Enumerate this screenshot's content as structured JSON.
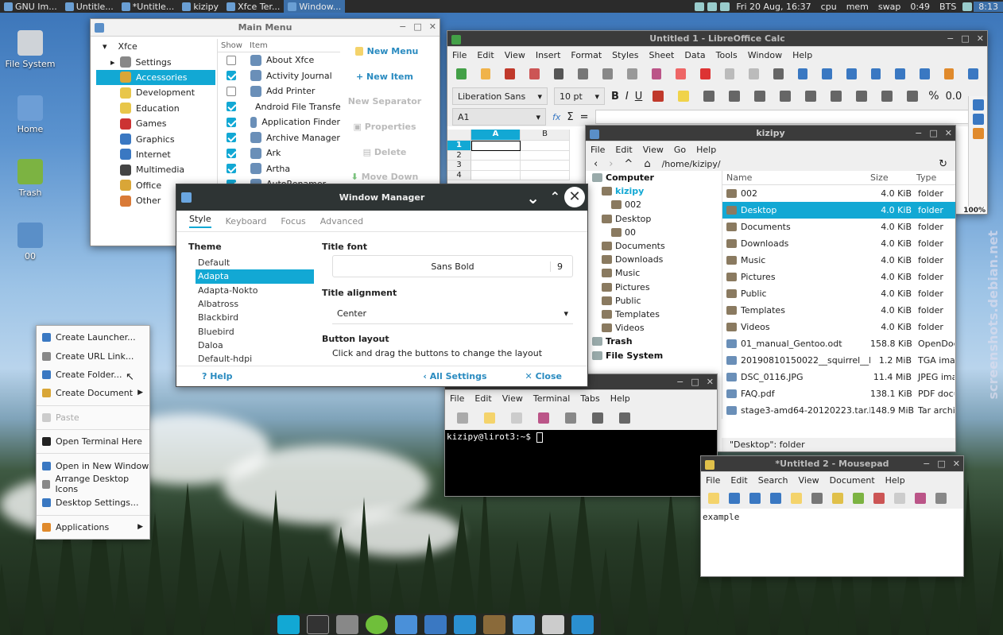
{
  "panel": {
    "tasks": [
      {
        "label": "GNU Im...",
        "active": false
      },
      {
        "label": "Untitle...",
        "active": false
      },
      {
        "label": "*Untitle...",
        "active": false
      },
      {
        "label": "kizipy",
        "active": false
      },
      {
        "label": "Xfce Ter...",
        "active": false
      },
      {
        "label": "Window...",
        "active": true
      }
    ],
    "clock": "Fri 20 Aug, 16:37",
    "cpu": "cpu",
    "mem": "mem",
    "swap": "swap",
    "uptime": "0:49",
    "bts": "BTS",
    "time": "8:13"
  },
  "desktop": {
    "icons": [
      {
        "label": "File System"
      },
      {
        "label": "Home"
      },
      {
        "label": "Trash"
      },
      {
        "label": "00"
      }
    ],
    "watermark": "screenshots.debian.net"
  },
  "main_menu": {
    "title": "Main Menu",
    "root": "Xfce",
    "categories": [
      "Settings",
      "Accessories",
      "Development",
      "Education",
      "Games",
      "Graphics",
      "Internet",
      "Multimedia",
      "Office",
      "Other"
    ],
    "selected_category": "Accessories",
    "col_show": "Show",
    "col_item": "Item",
    "items": [
      {
        "label": "About Xfce",
        "checked": false
      },
      {
        "label": "Activity Journal",
        "checked": true
      },
      {
        "label": "Add Printer",
        "checked": false
      },
      {
        "label": "Android File Transfe",
        "checked": true
      },
      {
        "label": "Application Finder",
        "checked": true
      },
      {
        "label": "Archive Manager",
        "checked": true
      },
      {
        "label": "Ark",
        "checked": true
      },
      {
        "label": "Artha",
        "checked": true
      },
      {
        "label": "AutoRenamer",
        "checked": true
      }
    ],
    "buttons": {
      "new_menu": "New Menu",
      "new_item": "New Item",
      "new_separator": "New Separator",
      "properties": "Properties",
      "delete": "Delete",
      "move_down": "Move Down"
    }
  },
  "calc": {
    "title": "Untitled 1 - LibreOffice Calc",
    "menu": [
      "File",
      "Edit",
      "View",
      "Insert",
      "Format",
      "Styles",
      "Sheet",
      "Data",
      "Tools",
      "Window",
      "Help"
    ],
    "font_name": "Liberation Sans",
    "font_size": "10 pt",
    "cell_ref": "A1",
    "col_a": "A",
    "col_b": "B",
    "rows": [
      "1",
      "2",
      "3",
      "4"
    ],
    "bold": "B",
    "italic": "I",
    "underline": "U",
    "fx": "fx",
    "sigma": "Σ",
    "equals": "=",
    "percent": "%",
    "decimal": "0.0",
    "zoom": "100%"
  },
  "window_manager": {
    "title": "Window Manager",
    "tabs": [
      "Style",
      "Keyboard",
      "Focus",
      "Advanced"
    ],
    "theme_label": "Theme",
    "themes": [
      "Default",
      "Adapta",
      "Adapta-Nokto",
      "Albatross",
      "Blackbird",
      "Bluebird",
      "Daloa",
      "Default-hdpi"
    ],
    "selected_theme": "Adapta",
    "title_font_label": "Title font",
    "font_value": "Sans Bold",
    "font_size": "9",
    "alignment_label": "Title alignment",
    "alignment_value": "Center",
    "button_layout_label": "Button layout",
    "button_layout_hint": "Click and drag the buttons to change the layout",
    "help": "Help",
    "all_settings": "All Settings",
    "close": "Close"
  },
  "thunar": {
    "title": "kizipy",
    "menu": [
      "File",
      "Edit",
      "View",
      "Go",
      "Help"
    ],
    "path": "/home/kizipy/",
    "sidebar": [
      {
        "label": "Computer",
        "level": 0,
        "bold": true
      },
      {
        "label": "kizipy",
        "level": 1,
        "bold": true
      },
      {
        "label": "002",
        "level": 2
      },
      {
        "label": "Desktop",
        "level": 1
      },
      {
        "label": "00",
        "level": 2
      },
      {
        "label": "Documents",
        "level": 1
      },
      {
        "label": "Downloads",
        "level": 1
      },
      {
        "label": "Music",
        "level": 1
      },
      {
        "label": "Pictures",
        "level": 1
      },
      {
        "label": "Public",
        "level": 1
      },
      {
        "label": "Templates",
        "level": 1
      },
      {
        "label": "Videos",
        "level": 1
      },
      {
        "label": "Trash",
        "level": 0,
        "bold": true
      },
      {
        "label": "File System",
        "level": 0,
        "bold": true
      }
    ],
    "columns": {
      "name": "Name",
      "size": "Size",
      "type": "Type"
    },
    "files": [
      {
        "name": "002",
        "size": "4.0 KiB",
        "type": "folder"
      },
      {
        "name": "Desktop",
        "size": "4.0 KiB",
        "type": "folder",
        "selected": true
      },
      {
        "name": "Documents",
        "size": "4.0 KiB",
        "type": "folder"
      },
      {
        "name": "Downloads",
        "size": "4.0 KiB",
        "type": "folder"
      },
      {
        "name": "Music",
        "size": "4.0 KiB",
        "type": "folder"
      },
      {
        "name": "Pictures",
        "size": "4.0 KiB",
        "type": "folder"
      },
      {
        "name": "Public",
        "size": "4.0 KiB",
        "type": "folder"
      },
      {
        "name": "Templates",
        "size": "4.0 KiB",
        "type": "folder"
      },
      {
        "name": "Videos",
        "size": "4.0 KiB",
        "type": "folder"
      },
      {
        "name": "01_manual_Gentoo.odt",
        "size": "158.8 KiB",
        "type": "OpenDocu"
      },
      {
        "name": "20190810150022__squirrel__b...",
        "size": "1.2 MiB",
        "type": "TGA imag"
      },
      {
        "name": "DSC_0116.JPG",
        "size": "11.4 MiB",
        "type": "JPEG imag"
      },
      {
        "name": "FAQ.pdf",
        "size": "138.1 KiB",
        "type": "PDF docu"
      },
      {
        "name": "stage3-amd64-20120223.tar.b...",
        "size": "148.9 MiB",
        "type": "Tar archiv"
      }
    ],
    "status": "\"Desktop\": folder"
  },
  "terminal": {
    "menu": [
      "File",
      "Edit",
      "View",
      "Terminal",
      "Tabs",
      "Help"
    ],
    "prompt": "kizipy@lirot3:~$ "
  },
  "mousepad": {
    "title": "*Untitled 2 - Mousepad",
    "menu": [
      "File",
      "Edit",
      "Search",
      "View",
      "Document",
      "Help"
    ],
    "content": "example"
  },
  "context_menu": {
    "items": [
      {
        "label": "Create Launcher...",
        "enabled": true
      },
      {
        "label": "Create URL Link...",
        "enabled": true
      },
      {
        "label": "Create Folder...",
        "enabled": true
      },
      {
        "label": "Create Document",
        "enabled": true,
        "submenu": true
      },
      {
        "sep": true
      },
      {
        "label": "Paste",
        "enabled": false
      },
      {
        "sep": true
      },
      {
        "label": "Open Terminal Here",
        "enabled": true
      },
      {
        "sep": true
      },
      {
        "label": "Open in New Window",
        "enabled": true
      },
      {
        "label": "Arrange Desktop Icons",
        "enabled": true
      },
      {
        "label": "Desktop Settings...",
        "enabled": true
      },
      {
        "sep": true
      },
      {
        "label": "Applications",
        "enabled": true,
        "submenu": true
      }
    ]
  },
  "colors": {
    "accent": "#12a8d4",
    "panel": "#2b2b2b",
    "wm_titlebar": "#2e3434"
  }
}
